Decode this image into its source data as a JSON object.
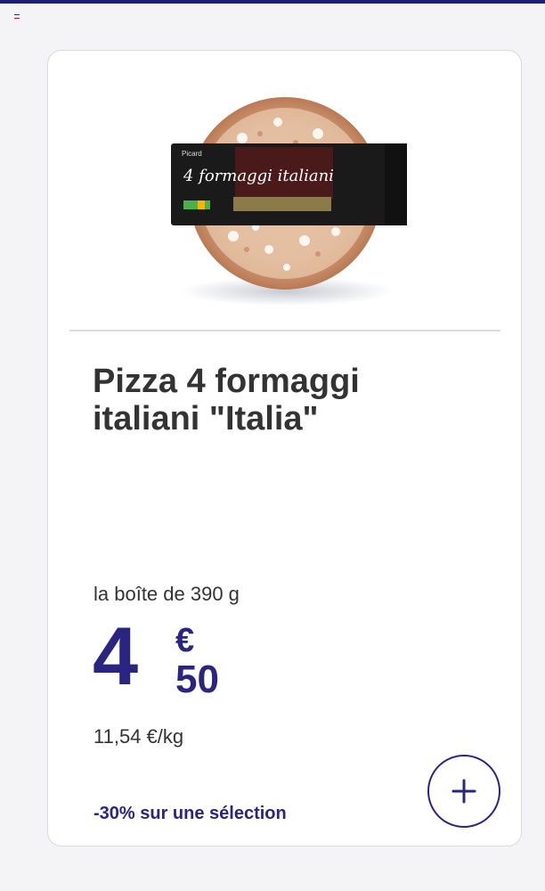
{
  "product": {
    "title": "Pizza 4 formaggi italiani \"Italia\"",
    "packaging": "la boîte de 390 g",
    "image_alt": "Pizza 4 formaggi italiani",
    "box_label": "4 formaggi italiani"
  },
  "price": {
    "integer": "4",
    "currency": "€",
    "decimal": "50",
    "per_kg": "11,54 €/kg"
  },
  "promo": {
    "text": "-30% sur une sélection"
  },
  "actions": {
    "add_icon": "plus-icon"
  },
  "colors": {
    "brand": "#2a2580",
    "topbar": "#1b1f7a",
    "text": "#333333",
    "card_border": "#d9d9de"
  }
}
